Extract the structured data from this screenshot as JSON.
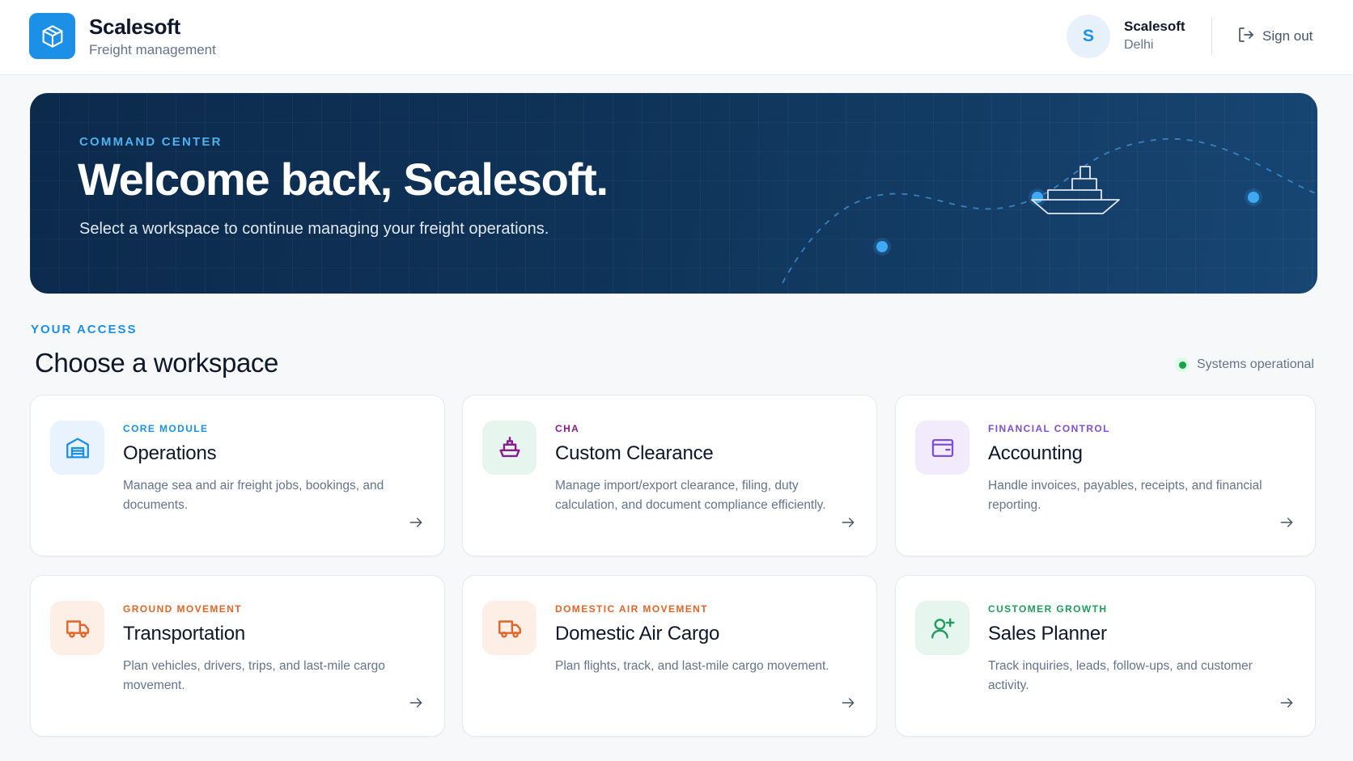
{
  "header": {
    "brand_name": "Scalesoft",
    "brand_tagline": "Freight management",
    "brand_icon": "package-icon",
    "user": {
      "initial": "S",
      "name": "Scalesoft",
      "location": "Delhi"
    },
    "sign_out_label": "Sign out"
  },
  "hero": {
    "eyebrow": "COMMAND CENTER",
    "title": "Welcome back, Scalesoft.",
    "subtitle": "Select a workspace to continue managing your freight operations."
  },
  "section": {
    "eyebrow": "YOUR ACCESS",
    "title": "Choose a workspace",
    "status": "Systems operational"
  },
  "workspaces": [
    {
      "eyebrow": "CORE MODULE",
      "title": "Operations",
      "description": "Manage sea and air freight jobs, bookings, and documents.",
      "icon": "warehouse-icon",
      "accent": "#1c8fe6",
      "tint": "#e8f3fd"
    },
    {
      "eyebrow": "CHA",
      "title": "Custom Clearance",
      "description": "Manage import/export clearance, filing, duty calculation, and document compliance efficiently.",
      "icon": "ship-icon",
      "accent": "#8b1a8f",
      "tint": "#e6f5ee"
    },
    {
      "eyebrow": "FINANCIAL CONTROL",
      "title": "Accounting",
      "description": "Handle invoices, payables, receipts, and financial reporting.",
      "icon": "wallet-icon",
      "accent": "#7c4fd4",
      "tint": "#f1ebfc"
    },
    {
      "eyebrow": "GROUND MOVEMENT",
      "title": "Transportation",
      "description": "Plan vehicles, drivers, trips, and last-mile cargo movement.",
      "icon": "truck-icon",
      "accent": "#e3652a",
      "tint": "#fdefe6"
    },
    {
      "eyebrow": "DOMESTIC AIR MOVEMENT",
      "title": "Domestic Air Cargo",
      "description": "Plan flights, track, and last-mile cargo movement.",
      "icon": "truck-icon",
      "accent": "#e3652a",
      "tint": "#fdefe6"
    },
    {
      "eyebrow": "CUSTOMER GROWTH",
      "title": "Sales Planner",
      "description": "Track inquiries, leads, follow-ups, and customer activity.",
      "icon": "user-plus-icon",
      "accent": "#1f9d5c",
      "tint": "#e6f5ee"
    }
  ]
}
